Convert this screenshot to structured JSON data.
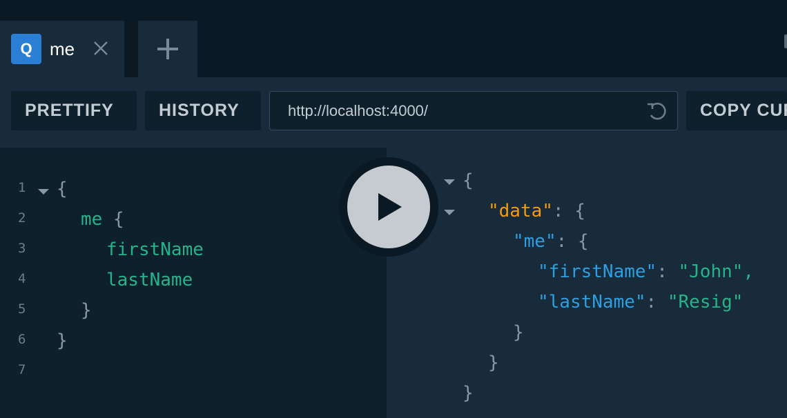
{
  "tabs": [
    {
      "badge": "Q",
      "name": "me",
      "close_icon": "close-icon"
    }
  ],
  "new_tab_icon": "plus-icon",
  "toolbar": {
    "prettify_label": "PRETTIFY",
    "history_label": "HISTORY",
    "url": "http://localhost:4000/",
    "reload_icon": "reload-icon",
    "copy_label": "COPY CURL"
  },
  "editor": {
    "line_numbers": [
      "1",
      "2",
      "3",
      "4",
      "5",
      "6",
      "7"
    ],
    "open_brace": "{",
    "query_field": "me",
    "inner_open": "{",
    "fields": [
      "firstName",
      "lastName"
    ],
    "inner_close": "}",
    "close_brace": "}"
  },
  "run_button_icon": "play-icon",
  "result": {
    "open": "{",
    "data_key": "\"data\"",
    "colon": ":",
    "brace": "{",
    "me_key": "\"me\"",
    "first_key": "\"firstName\"",
    "first_value": "\"John\",",
    "last_key": "\"lastName\"",
    "last_value": "\"Resig\"",
    "close": "}"
  },
  "colors": {
    "accent": "#2a7ed3",
    "field": "#26b38a",
    "key": "#2d9fe0",
    "data_key": "#f39c12"
  }
}
